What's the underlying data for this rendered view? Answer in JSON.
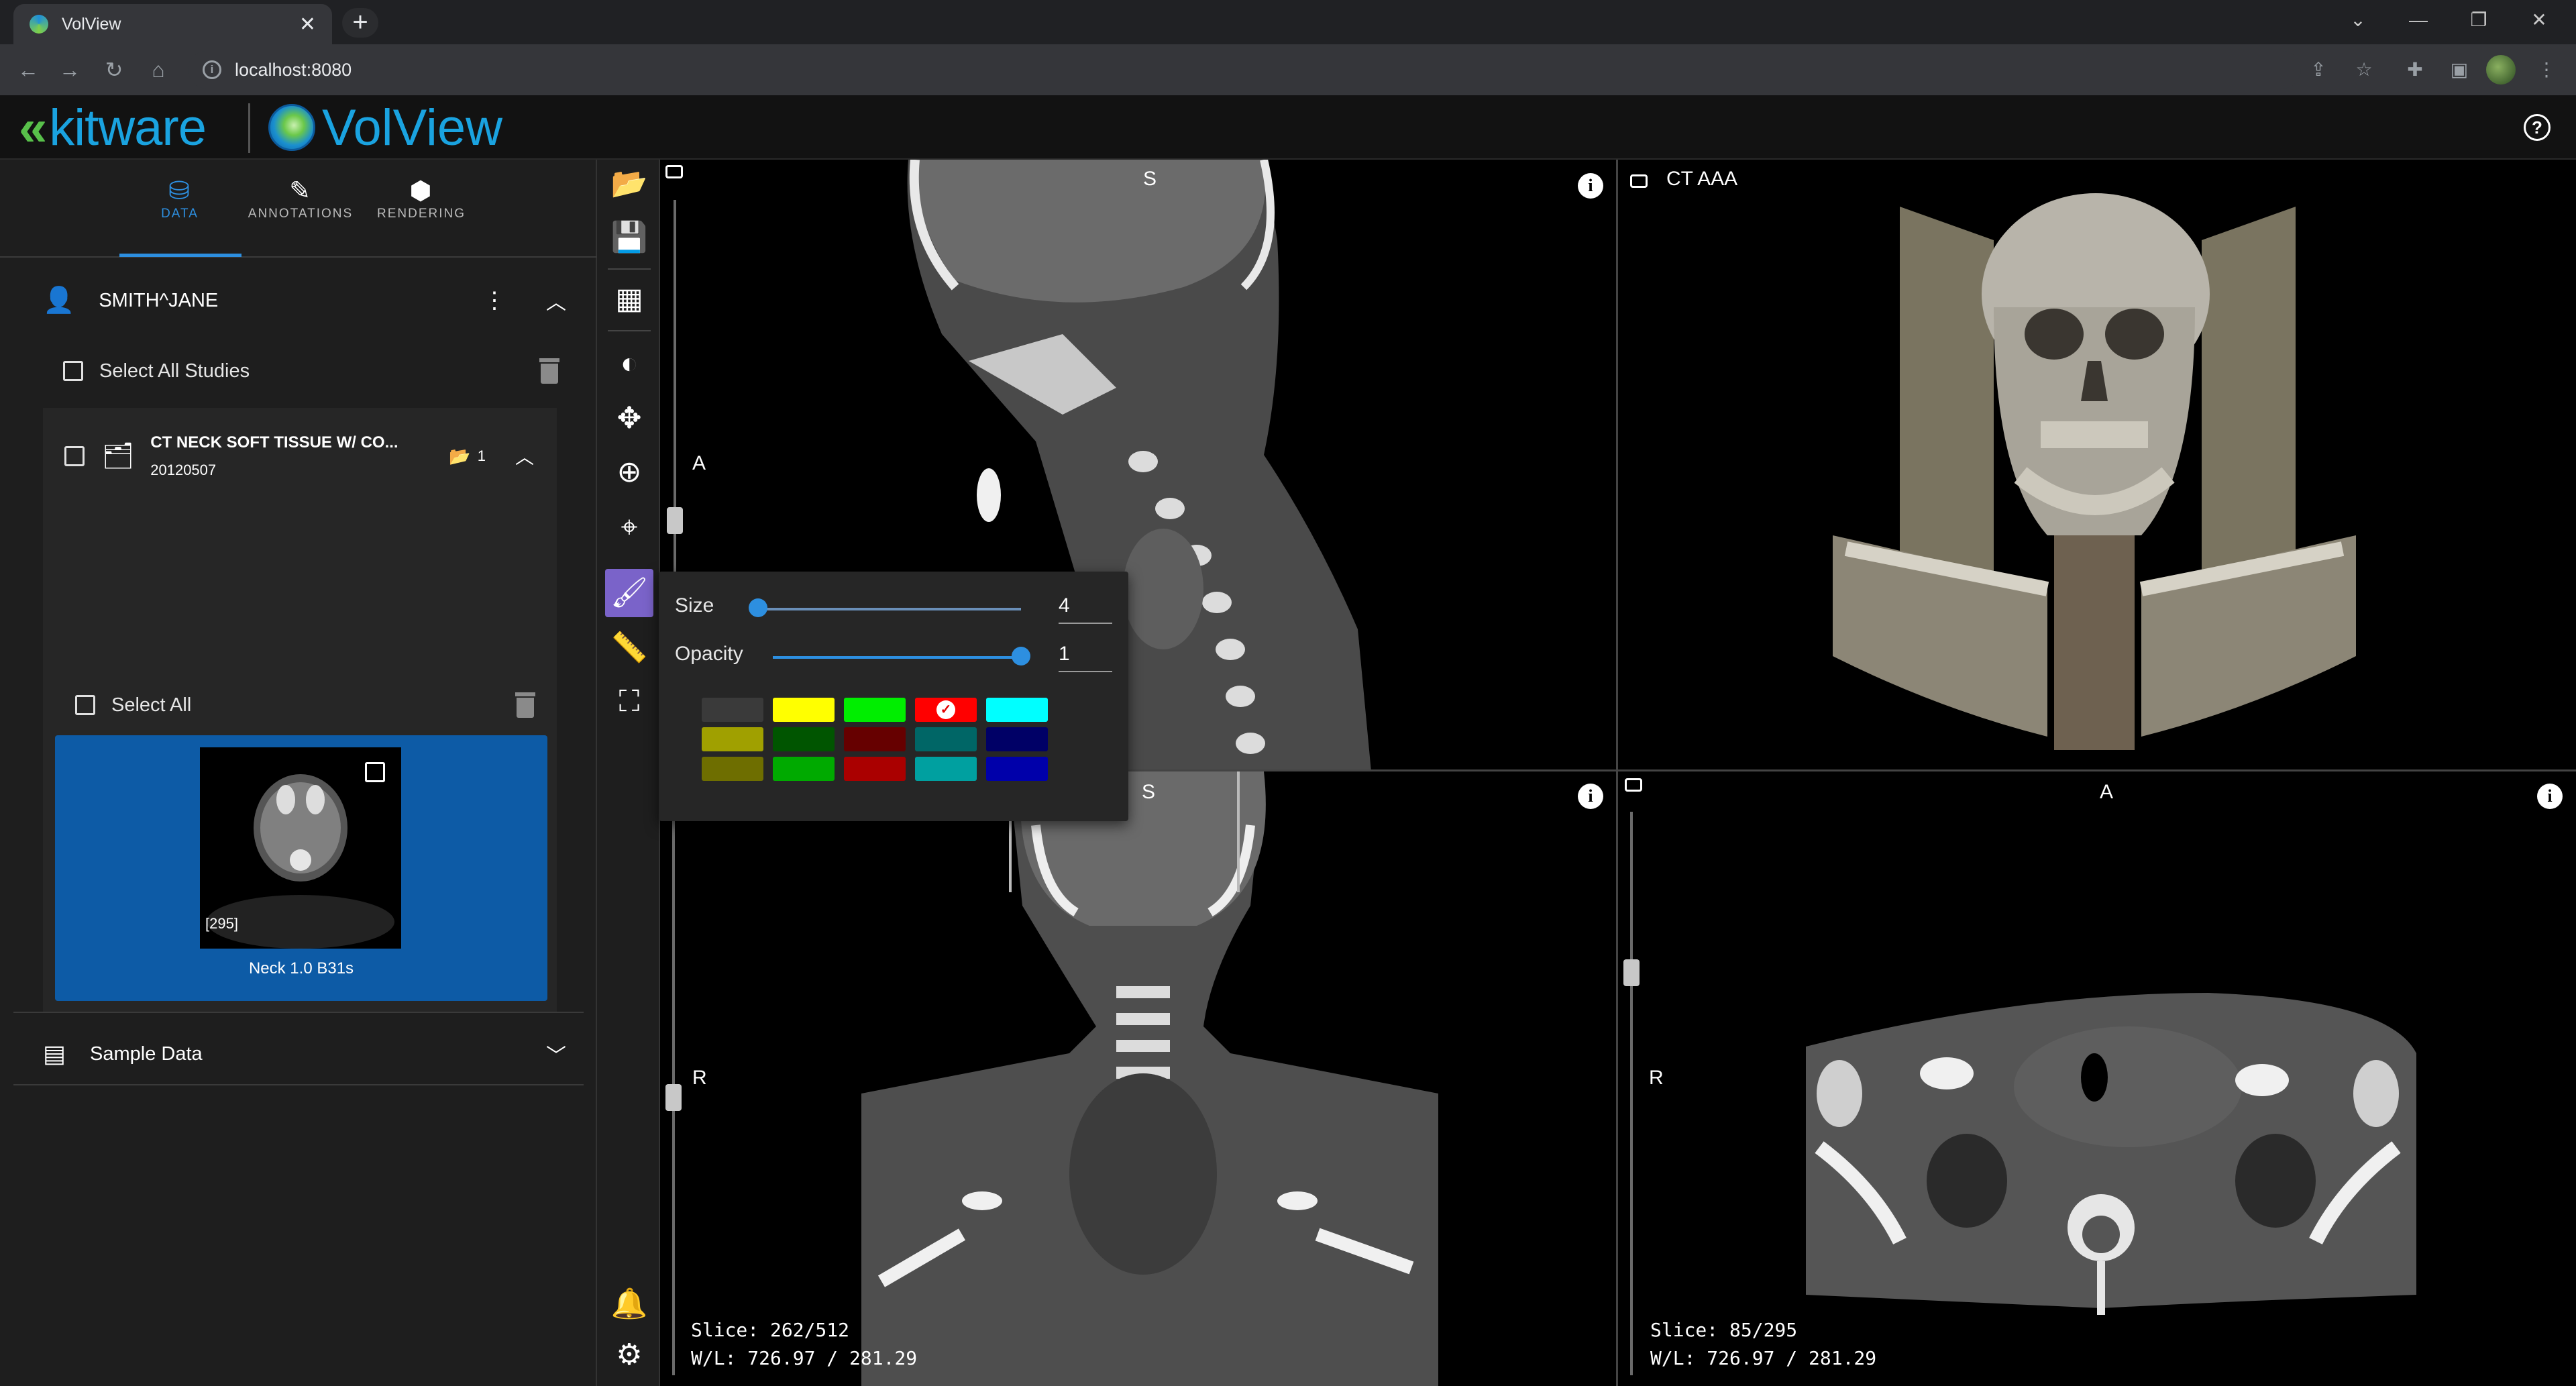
{
  "browser": {
    "tab_title": "VolView",
    "tab_close": "✕",
    "new_tab": "+",
    "url": "localhost:8080"
  },
  "app": {
    "brand_left": "kitware",
    "brand_right": "VolView",
    "help": "?"
  },
  "left_tabs": [
    {
      "label": "DATA",
      "icon": "database-icon"
    },
    {
      "label": "ANNOTATIONS",
      "icon": "pencil-icon"
    },
    {
      "label": "RENDERING",
      "icon": "cube-icon"
    }
  ],
  "patient": {
    "name": "SMITH^JANE"
  },
  "select_all_studies": "Select All Studies",
  "study": {
    "title": "CT NECK SOFT TISSUE W/ CO...",
    "date": "20120507",
    "series_count": "1",
    "select_all": "Select All"
  },
  "series": {
    "frames": "[295]",
    "name": "Neck 1.0 B31s"
  },
  "sample_data": "Sample Data",
  "views": {
    "sagittal": {
      "top": "S",
      "left": "A"
    },
    "threed": {
      "title": "CT AAA"
    },
    "coronal": {
      "top": "S",
      "left": "R",
      "slice": "Slice: 262/512",
      "wl": "W/L: 726.97 / 281.29"
    },
    "axial": {
      "top": "A",
      "left": "R",
      "slice": "Slice: 85/295",
      "wl": "W/L: 726.97 / 281.29"
    }
  },
  "paint": {
    "size_label": "Size",
    "size_value": "4",
    "size_fraction": 0.02,
    "opacity_label": "Opacity",
    "opacity_value": "1",
    "opacity_fraction": 1.0,
    "colors": [
      [
        "#3a3a3a",
        "#ffff00",
        "#00ee00",
        "#ff0000",
        "#00ffff"
      ],
      [
        "#a0a000",
        "#005500",
        "#660000",
        "#006666",
        "#000066"
      ],
      [
        "#6e6e00",
        "#00aa00",
        "#aa0000",
        "#00a0a0",
        "#0000aa"
      ]
    ],
    "selected": [
      0,
      3
    ]
  }
}
